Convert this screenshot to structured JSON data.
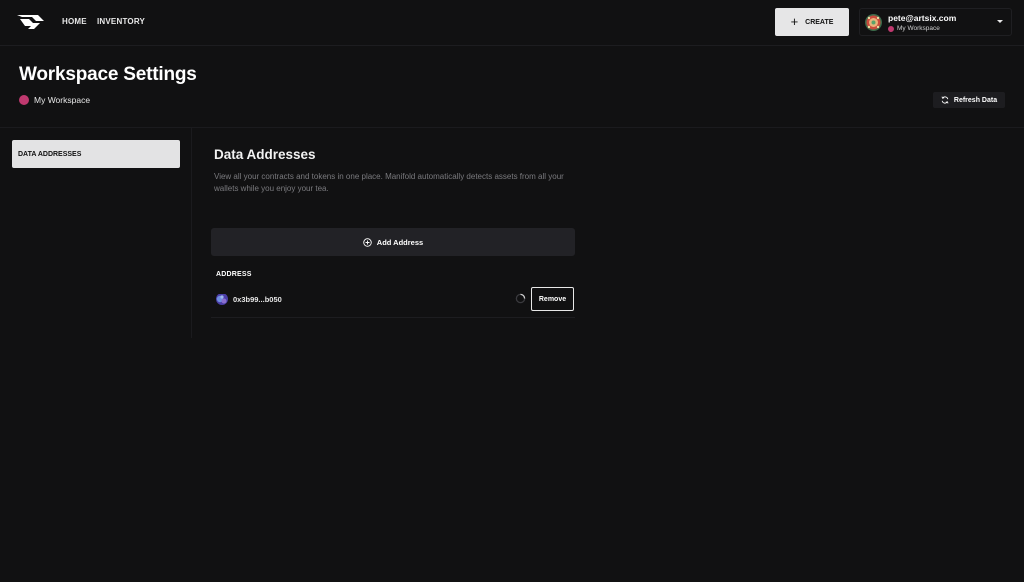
{
  "nav": {
    "home": "HOME",
    "inventory": "INVENTORY",
    "create": "CREATE"
  },
  "account": {
    "email": "pete@artsix.com",
    "workspace": "My Workspace"
  },
  "header": {
    "title": "Workspace Settings",
    "workspace": "My Workspace",
    "refresh": "Refresh Data"
  },
  "sidebar": {
    "items": [
      {
        "label": "DATA ADDRESSES",
        "active": true
      }
    ]
  },
  "main": {
    "title": "Data Addresses",
    "description": "View all your contracts and tokens in one place. Manifold automatically detects assets from all your wallets while you enjoy your tea.",
    "add_address": "Add Address",
    "column_header": "ADDRESS",
    "rows": [
      {
        "address": "0x3b99...b050",
        "action": "Remove"
      }
    ]
  },
  "colors": {
    "background": "#111112",
    "workspace_dot": "#c0396f",
    "button_light": "#e6e6e7",
    "panel": "#222226"
  },
  "icons": {
    "logo": "manifold-logo-icon",
    "create": "plus-icon",
    "refresh": "refresh-icon",
    "add": "plus-circle-icon",
    "dropdown": "caret-down-icon",
    "loading": "spinner-icon"
  }
}
